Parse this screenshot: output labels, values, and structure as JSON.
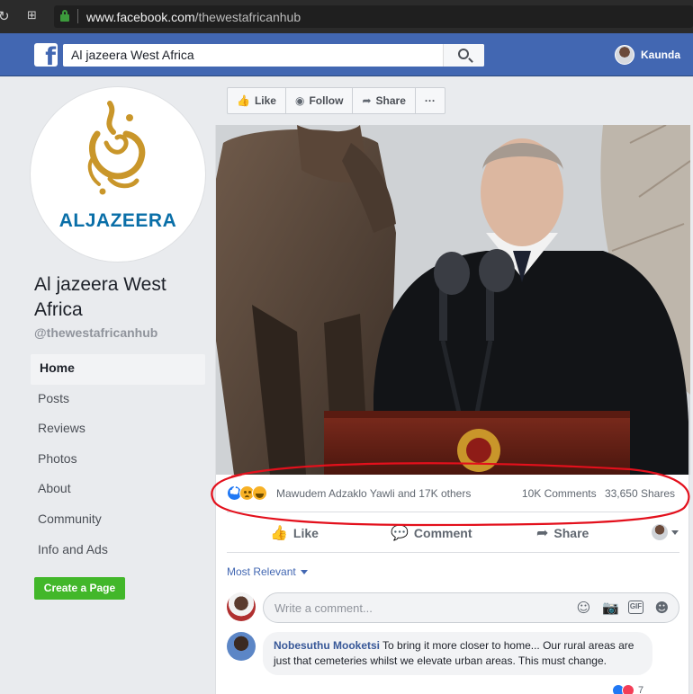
{
  "browser": {
    "url_domain": "www.facebook.com",
    "url_path": "/thewestafricanhub"
  },
  "header": {
    "search_query": "Al jazeera West Africa",
    "user_name": "Kaunda"
  },
  "page": {
    "logo_text": "ALJAZEERA",
    "name": "Al jazeera West Africa",
    "handle": "@thewestafricanhub",
    "nav": [
      "Home",
      "Posts",
      "Reviews",
      "Photos",
      "About",
      "Community",
      "Info and Ads"
    ],
    "create_page_label": "Create a Page"
  },
  "actions": {
    "like": "Like",
    "follow": "Follow",
    "share": "Share",
    "more": "···"
  },
  "post": {
    "reaction_names": "Mawudem Adzaklo Yawli and 17K others",
    "comments_count": "10K Comments",
    "shares_count": "33,650 Shares",
    "like_label": "Like",
    "comment_label": "Comment",
    "share_label": "Share",
    "sort_label": "Most Relevant",
    "comment_placeholder": "Write a comment...",
    "gif_label": "GIF"
  },
  "comment": {
    "author": "Nobesuthu Mooketsi",
    "text": "To bring it more closer to home... Our rural areas are just that cemeteries whilst we elevate urban areas. This must change.",
    "reaction_count": "7"
  },
  "colors": {
    "facebook_blue": "#4267b2",
    "create_green": "#42b72a",
    "annotation_red": "#e3101c"
  }
}
